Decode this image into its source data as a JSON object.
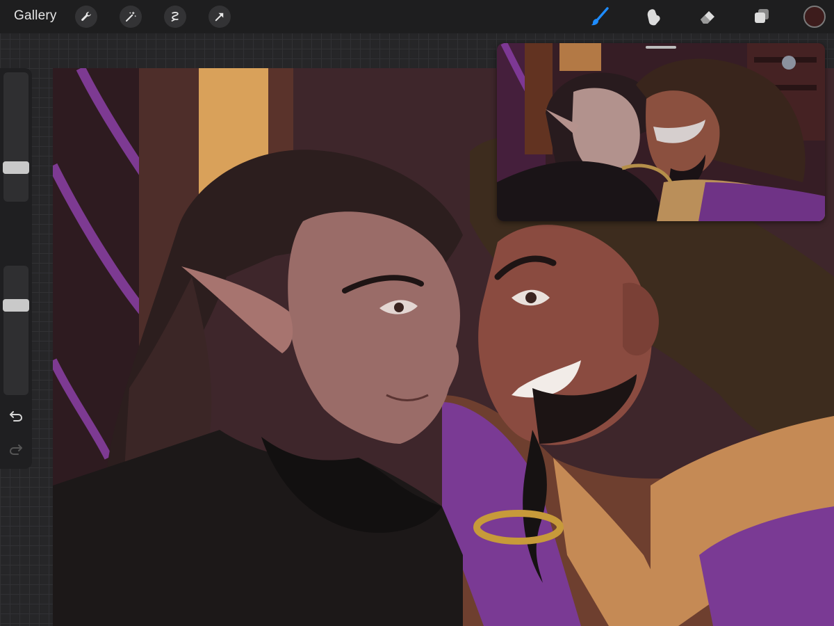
{
  "toolbar": {
    "gallery_label": "Gallery",
    "actions": [
      "wrench-icon",
      "magic-wand-icon",
      "selection-icon",
      "transform-arrow-icon"
    ],
    "tools": [
      "brush-icon",
      "smudge-icon",
      "eraser-icon",
      "layers-icon"
    ],
    "active_tool": "brush-icon",
    "current_color": "#3d1c1c",
    "accent_color": "#1e8cff"
  },
  "sidebar": {
    "brush_size_level": 0.73,
    "opacity_level": 0.7,
    "buttons": [
      "modify-square-icon",
      "undo-icon",
      "redo-icon"
    ]
  },
  "canvas": {
    "description_colors": [
      "#3b2328",
      "#7a3a8c",
      "#d9a15a",
      "#2a1e1e"
    ]
  },
  "reference_window": {
    "visible": true
  }
}
